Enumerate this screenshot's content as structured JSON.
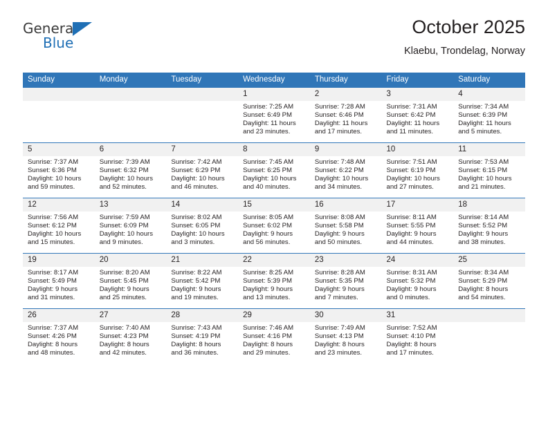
{
  "brand": {
    "name_top": "General",
    "name_bottom": "Blue",
    "accent_color": "#1f6fb5"
  },
  "header": {
    "title": "October 2025",
    "location": "Klaebu, Trondelag, Norway"
  },
  "theme": {
    "header_blue": "#3076b8",
    "daynum_band": "#f1f1f1",
    "text": "#231f20"
  },
  "weekdays": [
    "Sunday",
    "Monday",
    "Tuesday",
    "Wednesday",
    "Thursday",
    "Friday",
    "Saturday"
  ],
  "weeks": [
    [
      {
        "day": "",
        "lines": []
      },
      {
        "day": "",
        "lines": []
      },
      {
        "day": "",
        "lines": []
      },
      {
        "day": "1",
        "lines": [
          "Sunrise: 7:25 AM",
          "Sunset: 6:49 PM",
          "Daylight: 11 hours",
          "and 23 minutes."
        ]
      },
      {
        "day": "2",
        "lines": [
          "Sunrise: 7:28 AM",
          "Sunset: 6:46 PM",
          "Daylight: 11 hours",
          "and 17 minutes."
        ]
      },
      {
        "day": "3",
        "lines": [
          "Sunrise: 7:31 AM",
          "Sunset: 6:42 PM",
          "Daylight: 11 hours",
          "and 11 minutes."
        ]
      },
      {
        "day": "4",
        "lines": [
          "Sunrise: 7:34 AM",
          "Sunset: 6:39 PM",
          "Daylight: 11 hours",
          "and 5 minutes."
        ]
      }
    ],
    [
      {
        "day": "5",
        "lines": [
          "Sunrise: 7:37 AM",
          "Sunset: 6:36 PM",
          "Daylight: 10 hours",
          "and 59 minutes."
        ]
      },
      {
        "day": "6",
        "lines": [
          "Sunrise: 7:39 AM",
          "Sunset: 6:32 PM",
          "Daylight: 10 hours",
          "and 52 minutes."
        ]
      },
      {
        "day": "7",
        "lines": [
          "Sunrise: 7:42 AM",
          "Sunset: 6:29 PM",
          "Daylight: 10 hours",
          "and 46 minutes."
        ]
      },
      {
        "day": "8",
        "lines": [
          "Sunrise: 7:45 AM",
          "Sunset: 6:25 PM",
          "Daylight: 10 hours",
          "and 40 minutes."
        ]
      },
      {
        "day": "9",
        "lines": [
          "Sunrise: 7:48 AM",
          "Sunset: 6:22 PM",
          "Daylight: 10 hours",
          "and 34 minutes."
        ]
      },
      {
        "day": "10",
        "lines": [
          "Sunrise: 7:51 AM",
          "Sunset: 6:19 PM",
          "Daylight: 10 hours",
          "and 27 minutes."
        ]
      },
      {
        "day": "11",
        "lines": [
          "Sunrise: 7:53 AM",
          "Sunset: 6:15 PM",
          "Daylight: 10 hours",
          "and 21 minutes."
        ]
      }
    ],
    [
      {
        "day": "12",
        "lines": [
          "Sunrise: 7:56 AM",
          "Sunset: 6:12 PM",
          "Daylight: 10 hours",
          "and 15 minutes."
        ]
      },
      {
        "day": "13",
        "lines": [
          "Sunrise: 7:59 AM",
          "Sunset: 6:09 PM",
          "Daylight: 10 hours",
          "and 9 minutes."
        ]
      },
      {
        "day": "14",
        "lines": [
          "Sunrise: 8:02 AM",
          "Sunset: 6:05 PM",
          "Daylight: 10 hours",
          "and 3 minutes."
        ]
      },
      {
        "day": "15",
        "lines": [
          "Sunrise: 8:05 AM",
          "Sunset: 6:02 PM",
          "Daylight: 9 hours",
          "and 56 minutes."
        ]
      },
      {
        "day": "16",
        "lines": [
          "Sunrise: 8:08 AM",
          "Sunset: 5:58 PM",
          "Daylight: 9 hours",
          "and 50 minutes."
        ]
      },
      {
        "day": "17",
        "lines": [
          "Sunrise: 8:11 AM",
          "Sunset: 5:55 PM",
          "Daylight: 9 hours",
          "and 44 minutes."
        ]
      },
      {
        "day": "18",
        "lines": [
          "Sunrise: 8:14 AM",
          "Sunset: 5:52 PM",
          "Daylight: 9 hours",
          "and 38 minutes."
        ]
      }
    ],
    [
      {
        "day": "19",
        "lines": [
          "Sunrise: 8:17 AM",
          "Sunset: 5:49 PM",
          "Daylight: 9 hours",
          "and 31 minutes."
        ]
      },
      {
        "day": "20",
        "lines": [
          "Sunrise: 8:20 AM",
          "Sunset: 5:45 PM",
          "Daylight: 9 hours",
          "and 25 minutes."
        ]
      },
      {
        "day": "21",
        "lines": [
          "Sunrise: 8:22 AM",
          "Sunset: 5:42 PM",
          "Daylight: 9 hours",
          "and 19 minutes."
        ]
      },
      {
        "day": "22",
        "lines": [
          "Sunrise: 8:25 AM",
          "Sunset: 5:39 PM",
          "Daylight: 9 hours",
          "and 13 minutes."
        ]
      },
      {
        "day": "23",
        "lines": [
          "Sunrise: 8:28 AM",
          "Sunset: 5:35 PM",
          "Daylight: 9 hours",
          "and 7 minutes."
        ]
      },
      {
        "day": "24",
        "lines": [
          "Sunrise: 8:31 AM",
          "Sunset: 5:32 PM",
          "Daylight: 9 hours",
          "and 0 minutes."
        ]
      },
      {
        "day": "25",
        "lines": [
          "Sunrise: 8:34 AM",
          "Sunset: 5:29 PM",
          "Daylight: 8 hours",
          "and 54 minutes."
        ]
      }
    ],
    [
      {
        "day": "26",
        "lines": [
          "Sunrise: 7:37 AM",
          "Sunset: 4:26 PM",
          "Daylight: 8 hours",
          "and 48 minutes."
        ]
      },
      {
        "day": "27",
        "lines": [
          "Sunrise: 7:40 AM",
          "Sunset: 4:23 PM",
          "Daylight: 8 hours",
          "and 42 minutes."
        ]
      },
      {
        "day": "28",
        "lines": [
          "Sunrise: 7:43 AM",
          "Sunset: 4:19 PM",
          "Daylight: 8 hours",
          "and 36 minutes."
        ]
      },
      {
        "day": "29",
        "lines": [
          "Sunrise: 7:46 AM",
          "Sunset: 4:16 PM",
          "Daylight: 8 hours",
          "and 29 minutes."
        ]
      },
      {
        "day": "30",
        "lines": [
          "Sunrise: 7:49 AM",
          "Sunset: 4:13 PM",
          "Daylight: 8 hours",
          "and 23 minutes."
        ]
      },
      {
        "day": "31",
        "lines": [
          "Sunrise: 7:52 AM",
          "Sunset: 4:10 PM",
          "Daylight: 8 hours",
          "and 17 minutes."
        ]
      },
      {
        "day": "",
        "lines": []
      }
    ]
  ]
}
